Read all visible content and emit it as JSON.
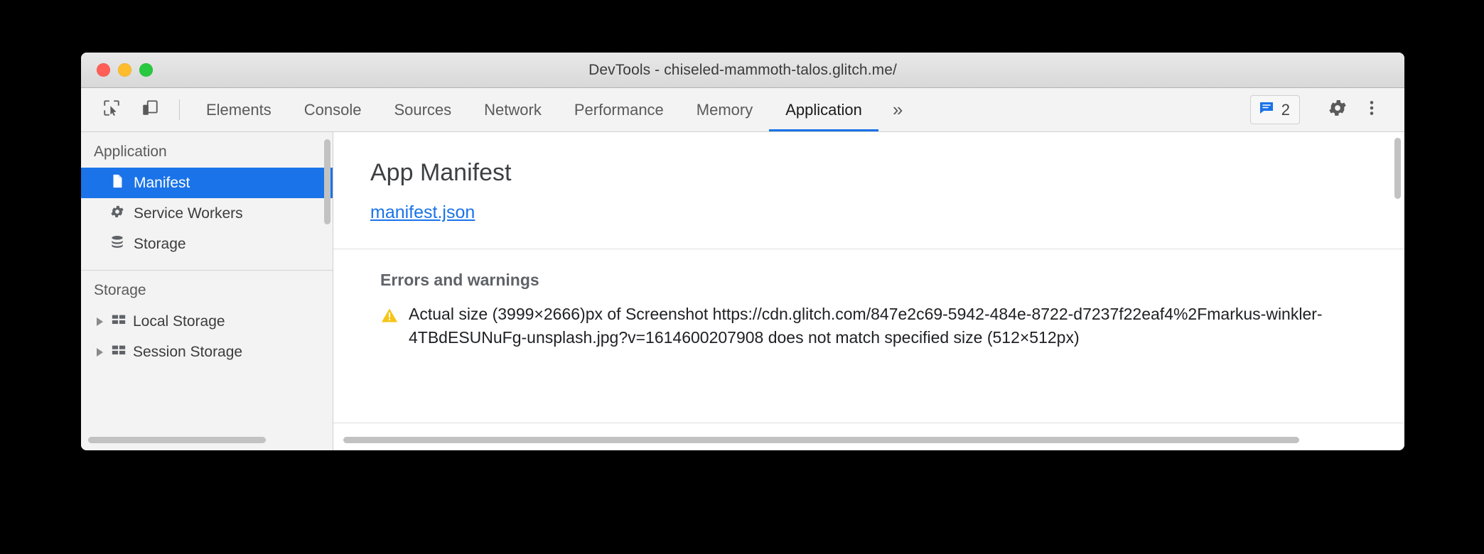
{
  "window": {
    "title": "DevTools - chiseled-mammoth-talos.glitch.me/",
    "traffic_lights": [
      "close",
      "minimize",
      "zoom"
    ]
  },
  "toolbar": {
    "inspect_icon": "inspect-cursor-icon",
    "device_icon": "device-toggle-icon",
    "issues_count": "2",
    "issues_icon": "issues-message-icon",
    "settings_icon": "gear-icon",
    "more_icon": "three-dot-menu-icon",
    "overflow_label": "»"
  },
  "tabs": [
    {
      "label": "Elements",
      "active": false
    },
    {
      "label": "Console",
      "active": false
    },
    {
      "label": "Sources",
      "active": false
    },
    {
      "label": "Network",
      "active": false
    },
    {
      "label": "Performance",
      "active": false
    },
    {
      "label": "Memory",
      "active": false
    },
    {
      "label": "Application",
      "active": true
    }
  ],
  "sidebar": {
    "sections": [
      {
        "title": "Application",
        "items": [
          {
            "label": "Manifest",
            "icon": "page-document-icon",
            "selected": true,
            "twisty": false
          },
          {
            "label": "Service Workers",
            "icon": "gear-icon",
            "selected": false,
            "twisty": false
          },
          {
            "label": "Storage",
            "icon": "database-stack-icon",
            "selected": false,
            "twisty": false
          }
        ]
      },
      {
        "title": "Storage",
        "items": [
          {
            "label": "Local Storage",
            "icon": "table-grid-icon",
            "selected": false,
            "twisty": true
          },
          {
            "label": "Session Storage",
            "icon": "table-grid-icon",
            "selected": false,
            "twisty": true
          }
        ]
      }
    ]
  },
  "main": {
    "title": "App Manifest",
    "manifest_link": "manifest.json",
    "errors_heading": "Errors and warnings",
    "warning_icon": "warning-triangle-icon",
    "error_message": "Actual size (3999×2666)px of Screenshot https://cdn.glitch.com/847e2c69-5942-484e-8722-d7237f22eaf4%2Fmarkus-winkler-4TBdESUNuFg-unsplash.jpg?v=1614600207908 does not match specified size (512×512px)"
  },
  "colors": {
    "accent_blue": "#1a73e8",
    "warning_yellow": "#f5c518",
    "titlebar_gray": "#e3e3e3",
    "sidebar_gray": "#f3f3f3"
  }
}
